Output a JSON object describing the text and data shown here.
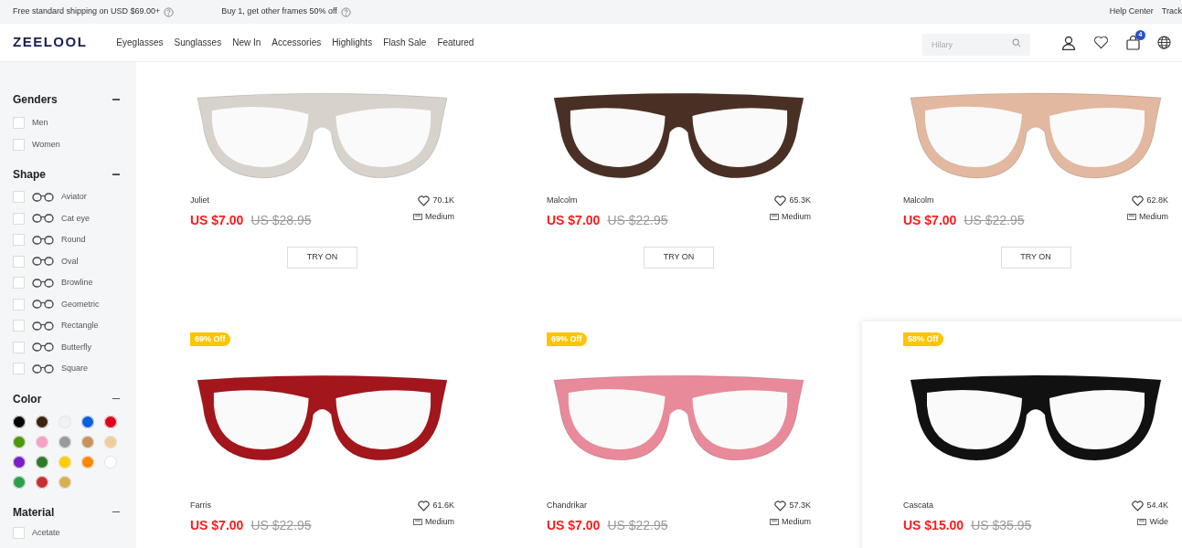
{
  "promo_bar": {
    "messages": [
      "Free standard shipping on USD $69.00+",
      "Buy 1, get other frames 50% off"
    ],
    "links": [
      "Help Center",
      "Track"
    ]
  },
  "header": {
    "logo": "ZEELOOL",
    "nav": [
      "Eyeglasses",
      "Sunglasses",
      "New In",
      "Accessories",
      "Highlights",
      "Flash Sale",
      "Featured"
    ],
    "search": {
      "placeholder": "Hilary"
    },
    "cart_count": "4"
  },
  "filters": {
    "genders": {
      "title": "Genders",
      "items": [
        {
          "label": "Men",
          "checked": false
        },
        {
          "label": "Women",
          "checked": false
        }
      ]
    },
    "shape": {
      "title": "Shape",
      "items": [
        {
          "label": "Aviator",
          "checked": false
        },
        {
          "label": "Cat eye",
          "checked": false
        },
        {
          "label": "Round",
          "checked": false
        },
        {
          "label": "Oval",
          "checked": false
        },
        {
          "label": "Browline",
          "checked": false
        },
        {
          "label": "Geometric",
          "checked": false
        },
        {
          "label": "Rectangle",
          "checked": false
        },
        {
          "label": "Butterfly",
          "checked": false
        },
        {
          "label": "Square",
          "checked": false
        }
      ]
    },
    "color": {
      "title": "Color",
      "swatches": [
        {
          "color": "#000000"
        },
        {
          "color": "#3a2410"
        },
        {
          "color": "#f2f2f2"
        },
        {
          "color": "#0a5fdc"
        },
        {
          "color": "#e0001b"
        },
        {
          "color": "#4a9a0a"
        },
        {
          "color": "#f7a1c4"
        },
        {
          "color": "#9a9a9a"
        },
        {
          "color": "#c8925e"
        },
        {
          "color": "#f2cd9c"
        },
        {
          "color": "#7a1ec8"
        },
        {
          "color": "#2f7a2a"
        },
        {
          "color": "#ffcc00"
        },
        {
          "color": "#ff8800"
        },
        {
          "color": "#ffffff"
        },
        {
          "color": "#2aa04a"
        },
        {
          "color": "#c83030"
        },
        {
          "color": "#d8b050"
        }
      ]
    },
    "material": {
      "title": "Material",
      "items": [
        {
          "label": "Acetate",
          "checked": false
        }
      ]
    }
  },
  "products": [
    {
      "name": "Juliet",
      "likes": "70.1K",
      "price": "US $7.00",
      "old_price": "US $28.95",
      "size": "Medium",
      "button": "TRY ON",
      "color": "#d8d2cc",
      "hovered": false
    },
    {
      "name": "Malcolm",
      "likes": "65.3K",
      "price": "US $7.00",
      "old_price": "US $22.95",
      "size": "Medium",
      "button": "TRY ON",
      "color": "#4a3024",
      "hovered": false
    },
    {
      "name": "Malcolm",
      "likes": "62.8K",
      "price": "US $7.00",
      "old_price": "US $22.95",
      "size": "Medium",
      "button": "TRY ON",
      "color": "#e2b8a0",
      "hovered": false
    },
    {
      "badge": "69% Off",
      "name": "Farris",
      "likes": "61.6K",
      "price": "US $7.00",
      "old_price": "US $22.95",
      "size": "Medium",
      "color": "#a3161c",
      "hovered": false
    },
    {
      "badge": "69% Off",
      "name": "Chandrikar",
      "likes": "57.3K",
      "price": "US $7.00",
      "old_price": "US $22.95",
      "size": "Medium",
      "color": "#e88a9a",
      "hovered": false
    },
    {
      "badge": "58% Off",
      "name": "Cascata",
      "likes": "54.4K",
      "price": "US $15.00",
      "old_price": "US $35.95",
      "size": "Wide",
      "color": "#111111",
      "hovered": true
    }
  ]
}
